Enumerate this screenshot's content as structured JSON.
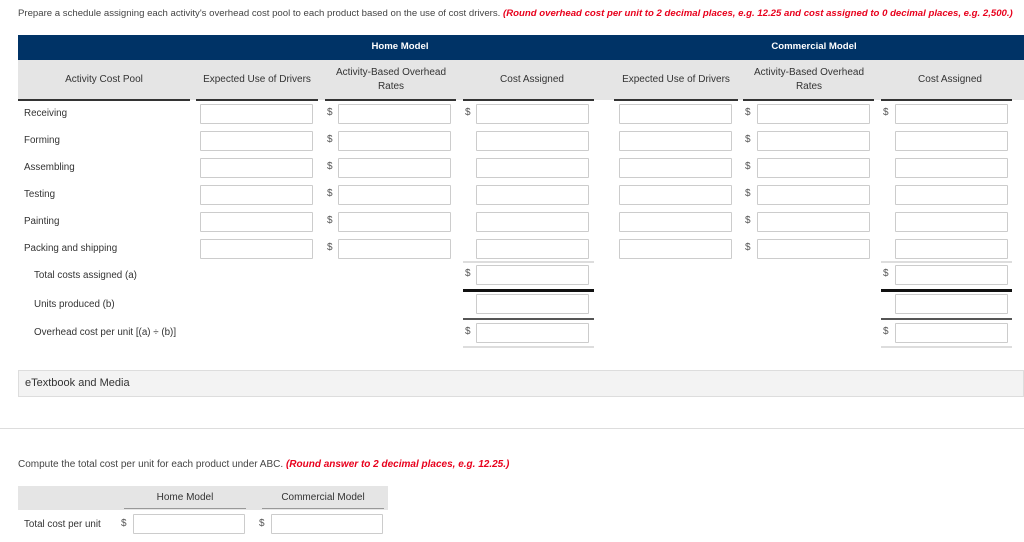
{
  "instructions": {
    "main": "Prepare a schedule assigning each activity's overhead cost pool to each product based on the use of cost drivers.",
    "note": "(Round overhead cost per unit to 2 decimal places, e.g. 12.25 and cost assigned to 0 decimal places, e.g. 2,500.)"
  },
  "table": {
    "groups": [
      "Home Model",
      "Commercial Model"
    ],
    "first_col_header": "Activity Cost Pool",
    "col_headers": {
      "expected": "Expected Use of Drivers",
      "rate": "Activity-Based Overhead Rates",
      "cost": "Cost Assigned"
    },
    "currency_symbol": "$",
    "activities": [
      "Receiving",
      "Forming",
      "Assembling",
      "Testing",
      "Painting",
      "Packing and shipping"
    ],
    "totals": {
      "total_costs": "Total costs assigned (a)",
      "units_produced": "Units produced (b)",
      "overhead_per_unit": "Overhead cost per unit [(a) ÷ (b)]"
    }
  },
  "etextbook": {
    "label": "eTextbook and Media"
  },
  "part2": {
    "instruction_main": "Compute the total cost per unit for each product under ABC.",
    "instruction_note": "(Round answer to 2 decimal places, e.g. 12.25.)",
    "headers": [
      "Home Model",
      "Commercial Model"
    ],
    "row_label": "Total cost per unit",
    "currency_symbol": "$"
  }
}
